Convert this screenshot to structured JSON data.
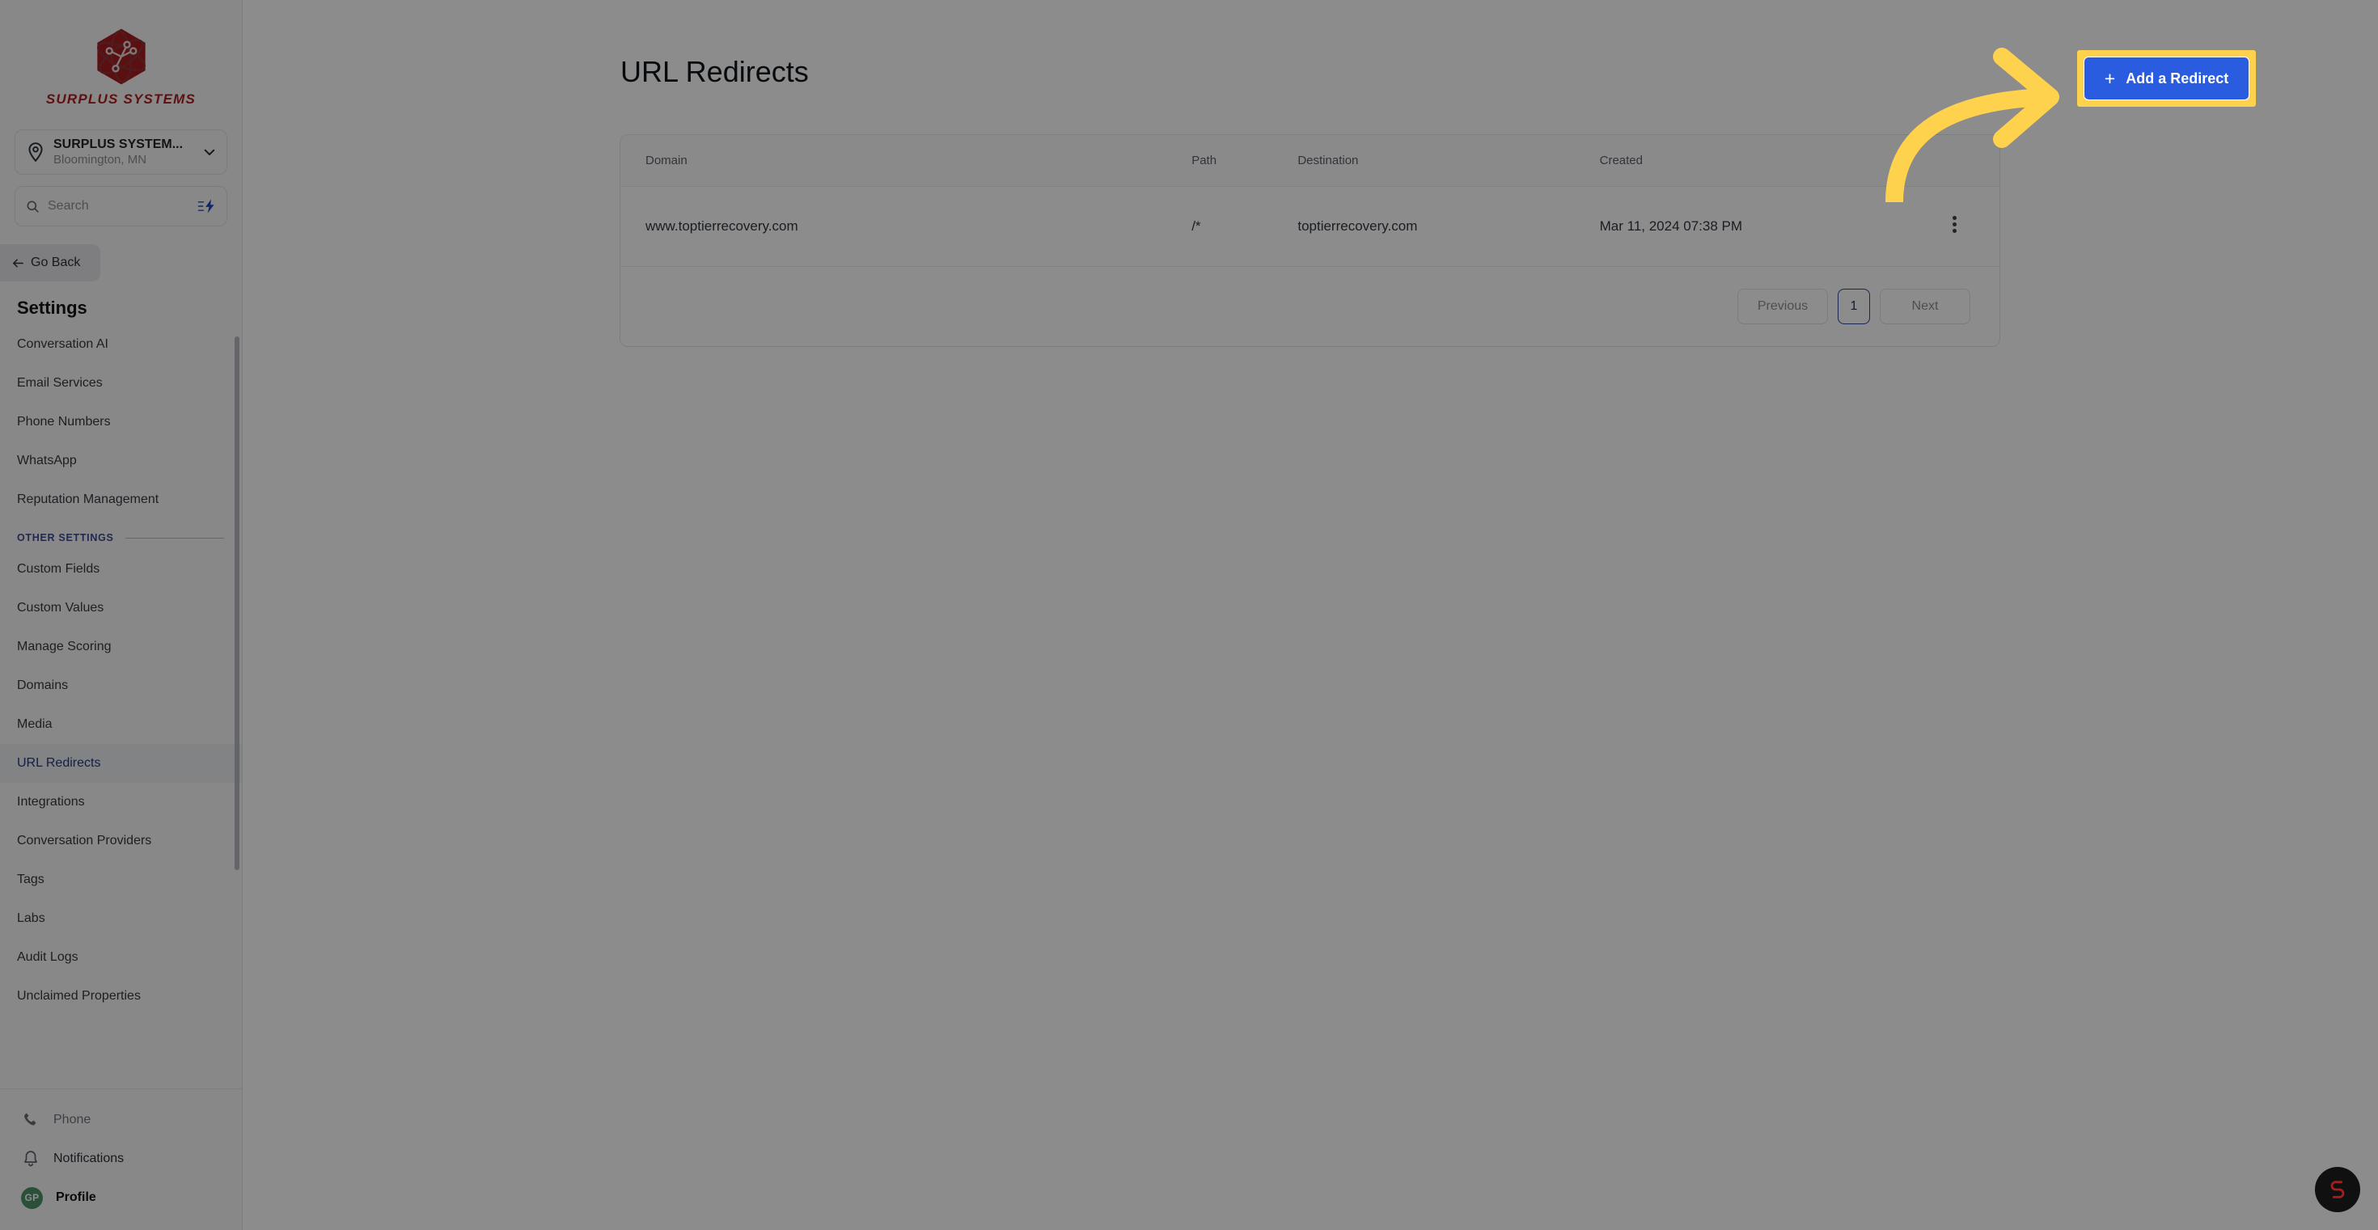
{
  "brand": {
    "logo_name": "surplus-systems-logo",
    "logo_text": "SURPLUS SYSTEMS",
    "logo_color": "#b01e20"
  },
  "sidebar": {
    "location": {
      "name": "SURPLUS SYSTEM...",
      "sublabel": "Bloomington, MN"
    },
    "search": {
      "placeholder": "Search"
    },
    "go_back_label": "Go Back",
    "section_title": "Settings",
    "primary_items": [
      {
        "label": "Conversation AI",
        "active": false
      },
      {
        "label": "Email Services",
        "active": false
      },
      {
        "label": "Phone Numbers",
        "active": false
      },
      {
        "label": "WhatsApp",
        "active": false
      },
      {
        "label": "Reputation Management",
        "active": false
      }
    ],
    "other_section_label": "OTHER SETTINGS",
    "other_items": [
      {
        "label": "Custom Fields",
        "active": false
      },
      {
        "label": "Custom Values",
        "active": false
      },
      {
        "label": "Manage Scoring",
        "active": false
      },
      {
        "label": "Domains",
        "active": false
      },
      {
        "label": "Media",
        "active": false
      },
      {
        "label": "URL Redirects",
        "active": true
      },
      {
        "label": "Integrations",
        "active": false
      },
      {
        "label": "Conversation Providers",
        "active": false
      },
      {
        "label": "Tags",
        "active": false
      },
      {
        "label": "Labs",
        "active": false
      },
      {
        "label": "Audit Logs",
        "active": false
      },
      {
        "label": "Unclaimed Properties",
        "active": false
      }
    ],
    "footer_items": [
      {
        "label": "Phone",
        "icon": "phone-icon"
      },
      {
        "label": "Notifications",
        "icon": "bell-icon"
      },
      {
        "label": "Profile",
        "icon": "avatar",
        "avatar_initials": "GP",
        "avatar_color": "#4e9268"
      }
    ]
  },
  "main": {
    "page_title": "URL Redirects",
    "add_button": {
      "label": "Add a Redirect",
      "plus": "+",
      "bg_color": "#2a5ce0",
      "highlight_color": "#ffd24d"
    },
    "table": {
      "headers": [
        "Domain",
        "Path",
        "Destination",
        "Created"
      ],
      "rows": [
        {
          "domain": "www.toptierrecovery.com",
          "path": "/*",
          "destination": "toptierrecovery.com",
          "created": "Mar 11, 2024 07:38 PM"
        }
      ]
    },
    "pagination": {
      "previous_label": "Previous",
      "current_page": "1",
      "next_label": "Next"
    }
  },
  "annotation": {
    "arrow_color": "#ffd24d",
    "arrow_name": "curved-arrow-pointing-to-add-redirect"
  },
  "fab": {
    "name": "support-chat-bubble",
    "bg_color": "#101010",
    "glyph_color": "#9e2020"
  }
}
